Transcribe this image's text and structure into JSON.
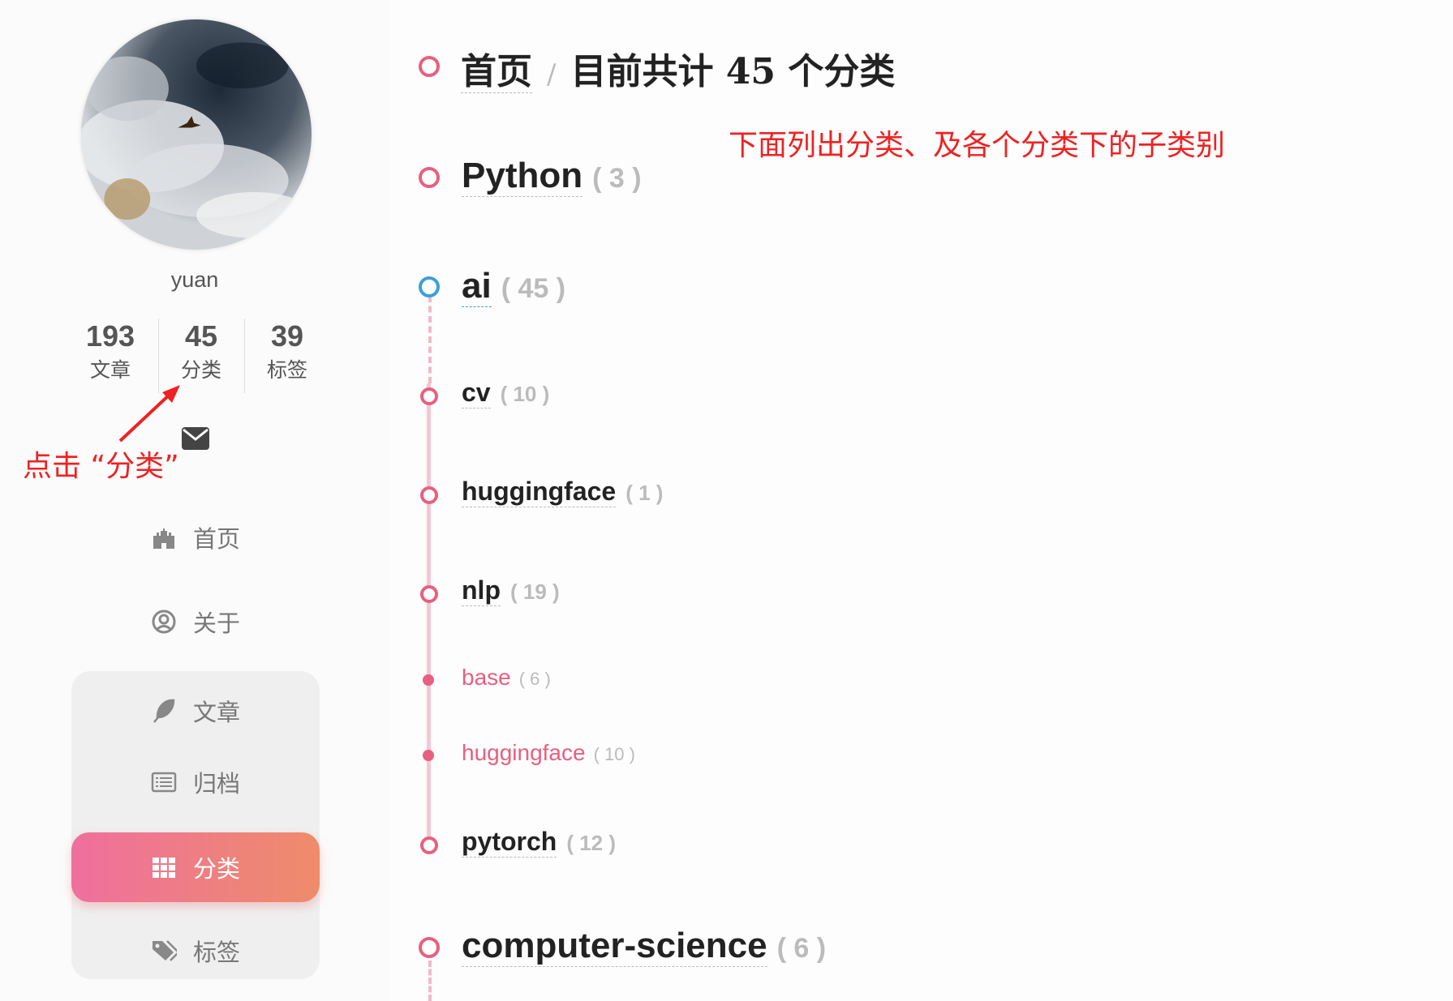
{
  "sidebar": {
    "username": "yuan",
    "stats": [
      {
        "value": "193",
        "label": "文章"
      },
      {
        "value": "45",
        "label": "分类"
      },
      {
        "value": "39",
        "label": "标签"
      }
    ],
    "annotation": "点击 “分类”",
    "menu": {
      "home": "首页",
      "about": "关于",
      "posts": "文章",
      "archive": "归档",
      "categories": "分类",
      "tags": "标签"
    }
  },
  "main": {
    "breadcrumb_home": "首页",
    "breadcrumb_sep": "/",
    "page_title": "目前共计 45 个分类",
    "annotation": "下面列出分类、及各个分类下的子类别",
    "categories": [
      {
        "name": "Python",
        "count": "( 3 )"
      },
      {
        "name": "ai",
        "count": "( 45 )"
      },
      {
        "name": "cv",
        "count": "( 10 )"
      },
      {
        "name": "huggingface",
        "count": "( 1 )"
      },
      {
        "name": "nlp",
        "count": "( 19 )"
      },
      {
        "name": "base",
        "count": "( 6 )"
      },
      {
        "name": "huggingface",
        "count": "( 10 )"
      },
      {
        "name": "pytorch",
        "count": "( 12 )"
      },
      {
        "name": "computer-science",
        "count": "( 6 )"
      }
    ]
  },
  "colors": {
    "accent": "#e85f80",
    "active_blue": "#3aa0d8",
    "annotation_red": "#ee2222",
    "menu_gradient_start": "#ef6f9e",
    "menu_gradient_end": "#ee8c6a"
  }
}
